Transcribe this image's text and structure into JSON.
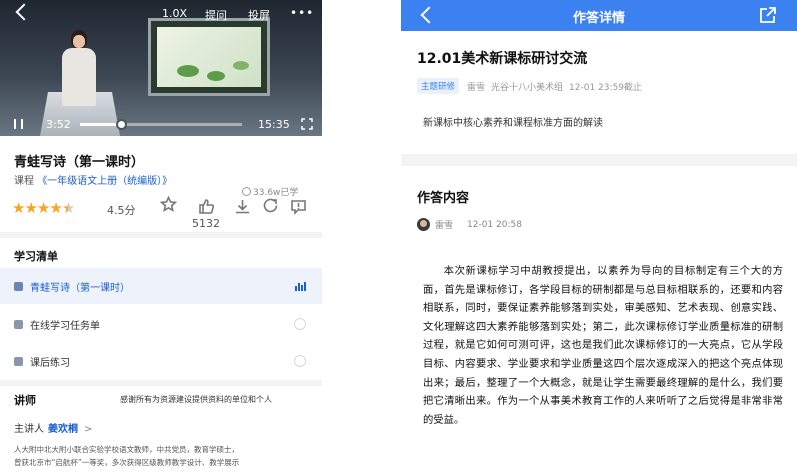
{
  "left": {
    "video": {
      "speed": "1.0X",
      "ask": "提问",
      "cast": "投屏",
      "more": "•••",
      "current_time": "3:52",
      "total_time": "15:35",
      "progress": 0.25
    },
    "course": {
      "title": "青蛙写诗（第一课时）",
      "category_prefix": "课程",
      "category_link": "《一年级语文上册（统编版）》",
      "views": "33.6w已学",
      "rating": 4.5,
      "rating_label": "4.5分",
      "like_count": "5132"
    },
    "icons": {
      "favorite": "star-outline-icon",
      "like": "thumb-up-icon",
      "download": "download-icon",
      "share": "share-icon",
      "comment": "comment-icon"
    },
    "study_list": {
      "heading": "学习清单",
      "items": [
        {
          "label": "青蛙写诗（第一课时）",
          "active": true
        },
        {
          "label": "在线学习任务单",
          "active": false
        },
        {
          "label": "课后练习",
          "active": false
        }
      ]
    },
    "teacher": {
      "heading": "讲师",
      "thanks": "感谢所有为资源建设提供资料的单位和个人",
      "presenter_label": "主讲人",
      "presenter_name": "姜欢桐",
      "chevron": ">",
      "bio_line1": "人大附中北大附小联合实验学校语文教师，中共党员，教育学硕士，",
      "bio_line2": "曾获北京市“启航杯”一等奖，多次获得区级教师教学设计、教学展示"
    },
    "accent_color": "#1a5fd0"
  },
  "right": {
    "nav": {
      "title": "作答详情",
      "bg_color": "#3b82f0"
    },
    "task": {
      "title": "12.01美术新课标研讨交流",
      "tag": "主题研修",
      "author": "雷雪",
      "group": "光谷十八小美术组",
      "deadline": "12-01 23:59截止",
      "description": "新课标中核心素养和课程标准方面的解读"
    },
    "answer": {
      "heading": "作答内容",
      "author": "雷雪",
      "time": "12-01 20:58",
      "body": "本次新课标学习中胡教授提出，以素养为导向的目标制定有三个大的方面，首先是课标修订，各学段目标的研制都是与总目标相联系的，还要和内容相联系，同时，要保证素养能够落到实处，审美感知、艺术表现、创意实践、文化理解这四大素养能够落到实处；第二，此次课标修订学业质量标准的研制过程，就是它如何可测可评，这也是我们此次课标修订的一大亮点，它从学段目标、内容要求、学业要求和学业质量这四个层次逐成深入的把这个亮点体现出来；最后，整理了一个大概念，就是让学生需要最终理解的是什么，我们要把它清晰出来。作为一个从事美术教育工作的人来听听了之后觉得是非常非常的受益。"
    }
  }
}
